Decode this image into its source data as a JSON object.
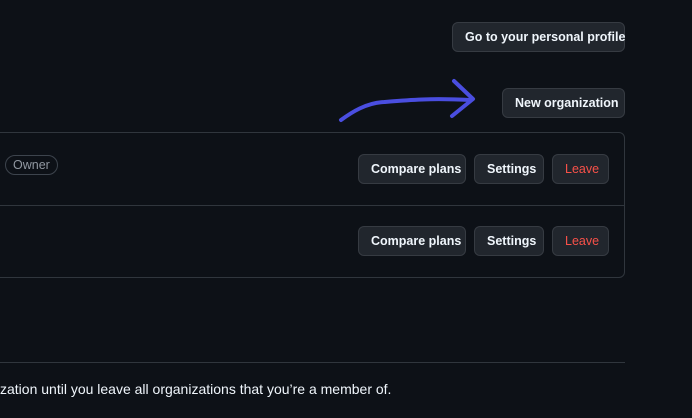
{
  "header": {
    "personal_profile_label": "Go to your personal profile",
    "new_org_label": "New organization"
  },
  "organizations": [
    {
      "badge": "Owner",
      "compare_label": "Compare plans",
      "settings_label": "Settings",
      "leave_label": "Leave"
    },
    {
      "compare_label": "Compare plans",
      "settings_label": "Settings",
      "leave_label": "Leave"
    }
  ],
  "footer": {
    "text": "zation until you leave all organizations that you’re a member of."
  },
  "colors": {
    "background": "#0d1117",
    "button_bg": "#21262d",
    "border": "#30363d",
    "danger": "#f85149",
    "annotation_arrow": "#4a4ee0"
  },
  "icons": [
    "annotation-arrow-icon"
  ]
}
